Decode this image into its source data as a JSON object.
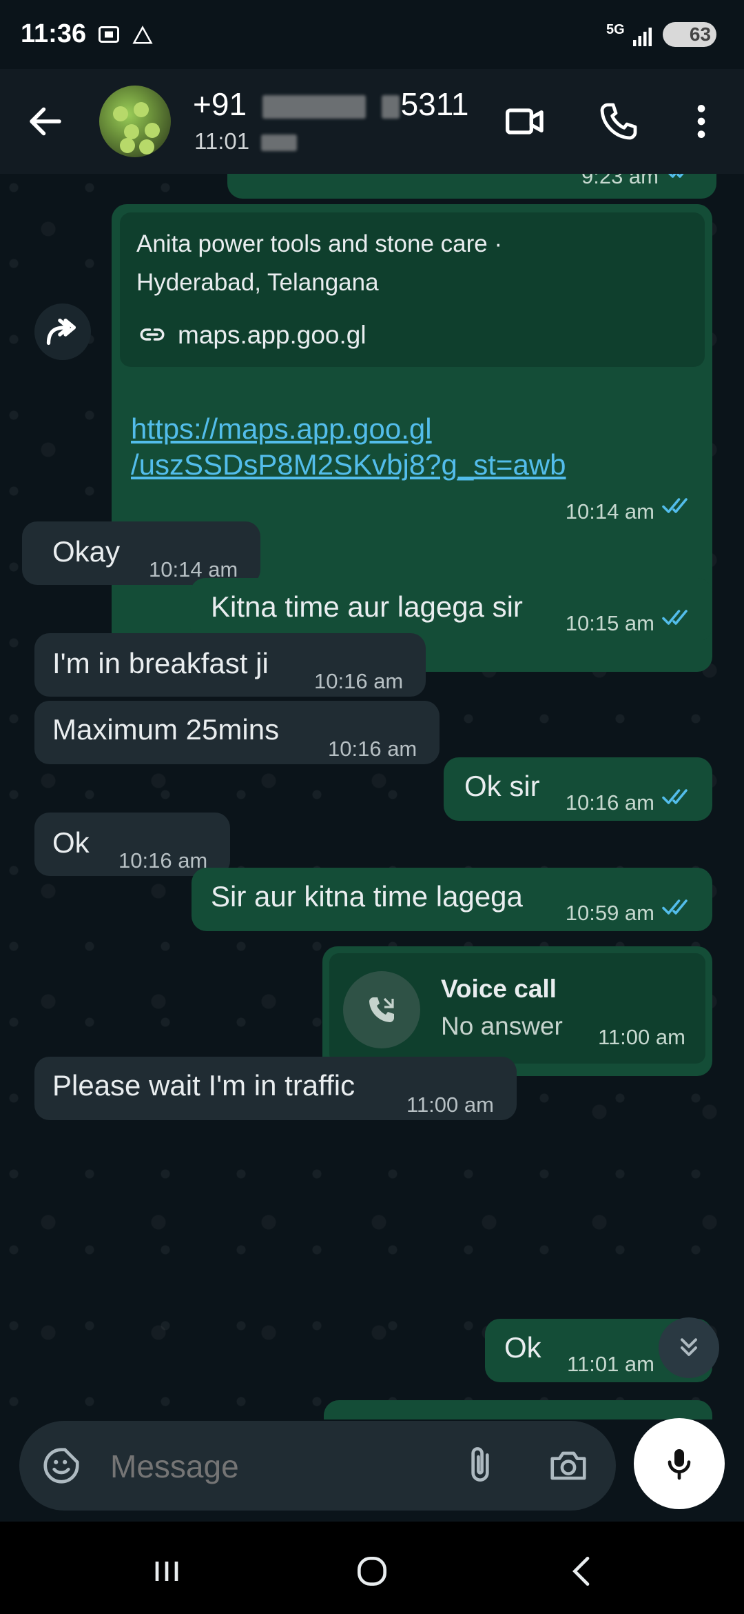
{
  "status_bar": {
    "time": "11:36",
    "network": "5G",
    "battery": "63"
  },
  "header": {
    "contact_prefix": "+91",
    "contact_suffix": "5311",
    "last_seen": "11:01"
  },
  "messages": {
    "top_partial_time": "9:23 am",
    "link_card": {
      "title": "Anita power tools and stone care · Hyderabad, Telangana",
      "domain": "maps.app.goo.gl",
      "url_line1": "https://maps.app.goo.gl",
      "url_line2": "/uszSSDsP8M2SKvbj8?g_st=awb",
      "time": "10:14 am"
    },
    "m1": {
      "text": "Okay",
      "time": "10:14 am"
    },
    "m2": {
      "text": "Kitna time aur lagega sir",
      "time": "10:15 am"
    },
    "m3": {
      "text": "I'm in breakfast ji",
      "time": "10:16 am"
    },
    "m4": {
      "text": "Maximum 25mins",
      "time": "10:16 am"
    },
    "m5": {
      "text": "Ok sir",
      "time": "10:16 am"
    },
    "m6": {
      "text": "Ok",
      "time": "10:16 am"
    },
    "m7": {
      "text": "Sir aur kitna time lagega",
      "time": "10:59 am"
    },
    "call": {
      "title": "Voice call",
      "status": "No answer",
      "time": "11:00 am"
    },
    "m8": {
      "text": "Please wait I'm in traffic",
      "time": "11:00 am"
    },
    "m9": {
      "text": "Ok",
      "time": "11:01 am"
    }
  },
  "composer": {
    "placeholder": "Message"
  },
  "colors": {
    "background": "#0b141a",
    "outgoing": "#144d37",
    "incoming": "#202c33",
    "read_ticks": "#53bdeb"
  }
}
